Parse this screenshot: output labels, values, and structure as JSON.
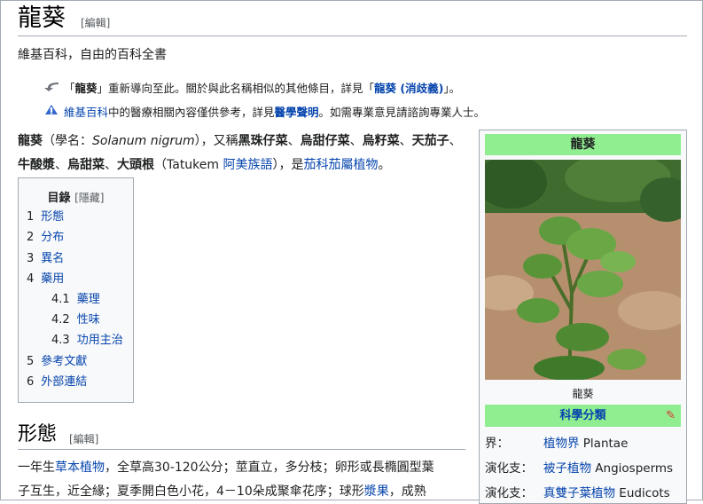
{
  "page": {
    "title": "龍葵",
    "title_edit": "[編輯]",
    "tagline": "維基百科，自由的百科全書"
  },
  "hatnotes": [
    {
      "prefix": "「",
      "bold": "龍葵",
      "mid": "」重新導向至此。關於與此名稱相似的其他條目，詳見「",
      "link": "龍葵 (消歧義)",
      "suffix": "」。",
      "icon": "redirect-arrow-icon"
    },
    {
      "link": "維基百科",
      "mid": "中的醫療相關內容僅供參考，詳見",
      "link2": "醫學聲明",
      "suffix": "。如需專業意見請諮詢專業人士。",
      "icon": "medical-disclaimer-icon"
    }
  ],
  "lead": {
    "term": "龍葵",
    "sci_label": "（學名：",
    "sci_name": "Solanum nigrum",
    "also": "），又稱",
    "alt1": "黑珠仔菜",
    "alt2": "烏甜仔菜",
    "alt3": "烏籽菜",
    "alt4": "天茄子",
    "alt5": "牛酸漿",
    "alt6": "烏甜菜",
    "alt7": "大頭根",
    "sep": "、",
    "tatukem_pre": "（Tatukem ",
    "ami_link": "阿美族語",
    "tatukem_post": "），是",
    "genus_link": "茄科茄屬植物",
    "end": "。"
  },
  "toc": {
    "title": "目錄",
    "toggle": "[隱藏]",
    "items": [
      {
        "num": "1",
        "label": "形態"
      },
      {
        "num": "2",
        "label": "分布"
      },
      {
        "num": "3",
        "label": "異名"
      },
      {
        "num": "4",
        "label": "藥用"
      },
      {
        "num": "4.1",
        "label": "藥理"
      },
      {
        "num": "4.2",
        "label": "性味"
      },
      {
        "num": "4.3",
        "label": "功用主治"
      },
      {
        "num": "5",
        "label": "參考文獻"
      },
      {
        "num": "6",
        "label": "外部連結"
      }
    ]
  },
  "section": {
    "heading": "形態",
    "edit": "[編輯]",
    "line1_pre": "一年生",
    "line1_link": "草本植物",
    "line1_post": "，全草高30-120公分；莖直立，多分枝；卵形或長橢圓型葉",
    "line2_pre": "子互生，近全緣；夏季開白色小花，4－10朵成聚傘花序；球形",
    "line2_link": "漿果",
    "line2_post": "，成熟"
  },
  "infobox": {
    "title": "龍葵",
    "caption": "龍葵",
    "sci_header": "科學分類",
    "rows": [
      {
        "key": "界：",
        "link": "植物界",
        "extra": " Plantae"
      },
      {
        "key": "演化支：",
        "link": "被子植物",
        "extra": " Angiosperms"
      },
      {
        "key": "演化支：",
        "link": "真雙子葉植物",
        "extra": " Eudicots"
      }
    ]
  }
}
